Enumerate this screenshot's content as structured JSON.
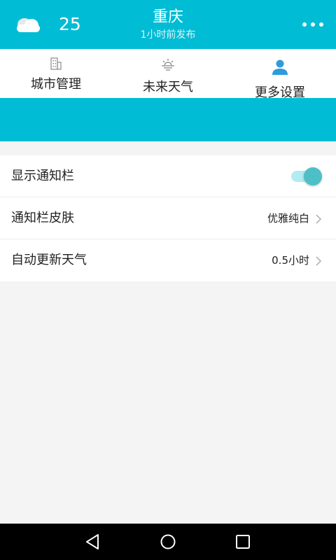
{
  "header": {
    "weather_icon": "cloud-icon",
    "temperature": "25",
    "city": "重庆",
    "published": "1小时前发布",
    "more_icon": "more-horizontal-icon"
  },
  "nav": {
    "items": [
      {
        "label": "城市管理",
        "icon": "building-icon"
      },
      {
        "label": "未来天气",
        "icon": "sunrise-icon"
      },
      {
        "label": "更多设置",
        "icon": "person-icon"
      }
    ]
  },
  "settings": {
    "rows": [
      {
        "label": "显示通知栏",
        "toggle_on": true
      },
      {
        "label": "通知栏皮肤",
        "value": "优雅纯白"
      },
      {
        "label": "自动更新天气",
        "value": "0.5小时"
      }
    ]
  },
  "colors": {
    "primary": "#00bcd4",
    "toggle_knob": "#4dbfc7",
    "toggle_track": "#b2ebf2",
    "person_icon": "#2d9cdb",
    "background": "#f4f4f4"
  },
  "system_nav": {
    "icons": [
      "back-icon",
      "home-icon",
      "recents-icon"
    ]
  }
}
